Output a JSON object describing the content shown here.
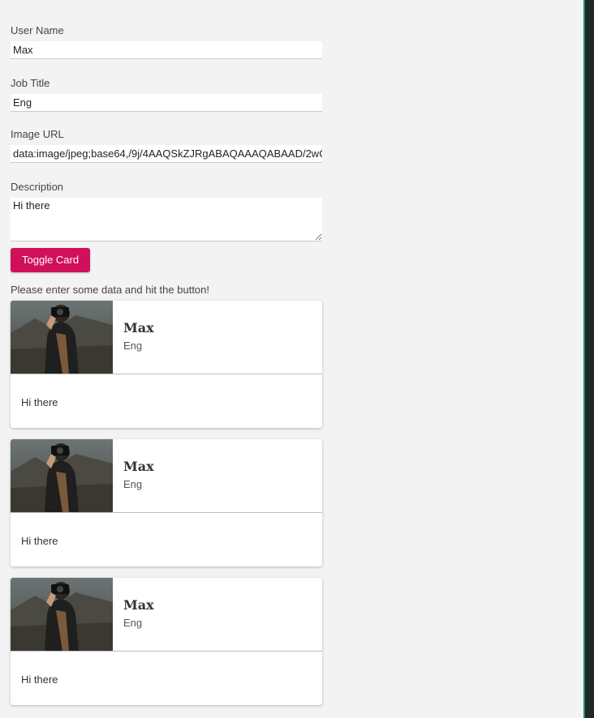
{
  "form": {
    "username_label": "User Name",
    "username_value": "Max",
    "jobtitle_label": "Job Title",
    "jobtitle_value": "Eng",
    "imageurl_label": "Image URL",
    "imageurl_value": "data:image/jpeg;base64,/9j/4AAQSkZJRgABAQAAAQABAAD/2wC",
    "description_label": "Description",
    "description_value": "Hi there",
    "toggle_button_label": "Toggle Card",
    "hint": "Please enter some data and hit the button!"
  },
  "cards": [
    {
      "name": "Max",
      "job": "Eng",
      "description": "Hi there"
    },
    {
      "name": "Max",
      "job": "Eng",
      "description": "Hi there"
    },
    {
      "name": "Max",
      "job": "Eng",
      "description": "Hi there"
    }
  ],
  "colors": {
    "button": "#d1105c",
    "background": "#f3f3f3",
    "card": "#ffffff"
  }
}
